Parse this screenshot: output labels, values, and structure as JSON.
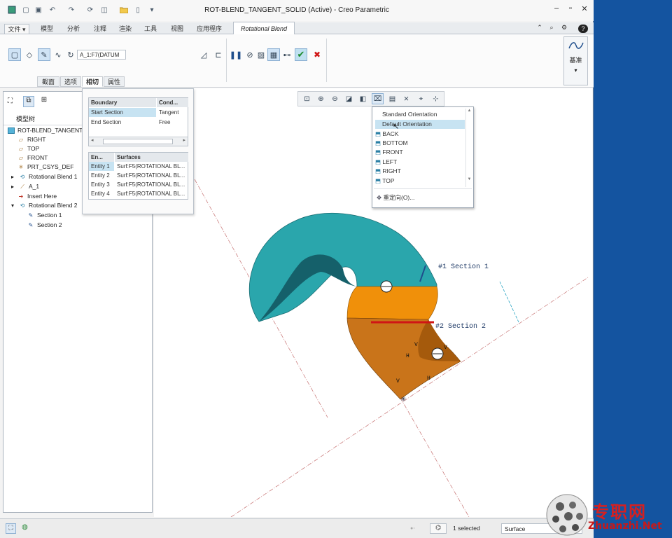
{
  "window": {
    "title": "ROT-BLEND_TANGENT_SOLID (Active) - Creo Parametric"
  },
  "menu": {
    "tabs": [
      "文件",
      "模型",
      "分析",
      "注释",
      "渲染",
      "工具",
      "视图",
      "应用程序"
    ],
    "active_tab": "Rotational Blend"
  },
  "ribbon": {
    "reference_field": "A_1:F7(DATUM",
    "basis_label": "基准"
  },
  "subtabs": [
    "截面",
    "选项",
    "相切",
    "属性"
  ],
  "boundary_table": {
    "headers": [
      "Boundary",
      "Cond..."
    ],
    "rows": [
      [
        "Start Section",
        "Tangent"
      ],
      [
        "End Section",
        "Free"
      ]
    ]
  },
  "surface_table": {
    "headers": [
      "En...",
      "Surfaces"
    ],
    "rows": [
      [
        "Entity 1",
        "Surf:F5(ROTATIONAL BL..."
      ],
      [
        "Entity 2",
        "Surf:F5(ROTATIONAL BL..."
      ],
      [
        "Entity 3",
        "Surf:F5(ROTATIONAL BL..."
      ],
      [
        "Entity 4",
        "Surf:F5(ROTATIONAL BL..."
      ]
    ]
  },
  "model_tree": {
    "header": "模型树",
    "items": [
      "ROT-BLEND_TANGENT",
      "RIGHT",
      "TOP",
      "FRONT",
      "PRT_CSYS_DEF",
      "Rotational Blend 1",
      "A_1",
      "Insert Here",
      "Rotational Blend 2",
      "Section 1",
      "Section 2"
    ]
  },
  "orientation_menu": {
    "items": [
      "Standard Orientation",
      "Default Orientation",
      "BACK",
      "BOTTOM",
      "FRONT",
      "LEFT",
      "RIGHT",
      "TOP"
    ],
    "reorient": "重定向(O)..."
  },
  "canvas": {
    "section1_label": "#1 Section 1",
    "section2_label": "#2 Section 2",
    "h": "H",
    "v": "V"
  },
  "status": {
    "selected": "1 selected",
    "filter": "Surface"
  },
  "watermark": {
    "cn": "专职网",
    "url": "Zhuanzhi.Net"
  },
  "colors": {
    "teal": "#2aa6ac",
    "orange": "#f0900a",
    "bg_right": "#1454a0"
  }
}
